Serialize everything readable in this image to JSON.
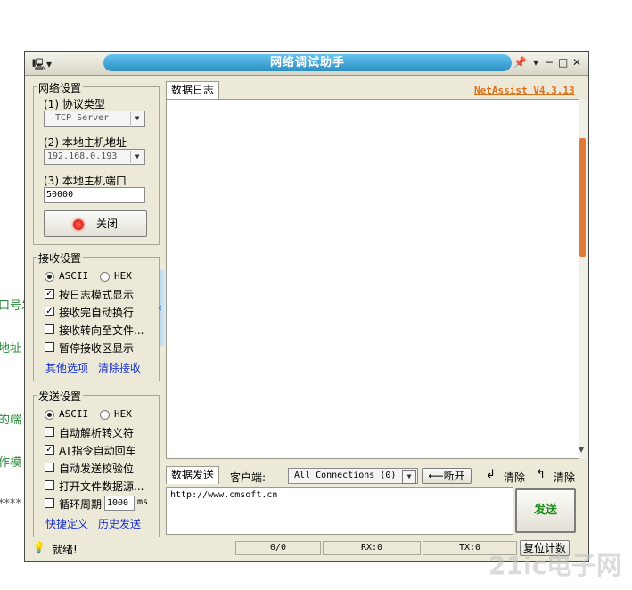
{
  "background": {
    "fragments": [
      "口号发",
      "地址",
      "的端",
      "作模",
      "****"
    ]
  },
  "window": {
    "title": "网络调试助手",
    "version_link": "NetAssist V4.3.13"
  },
  "network": {
    "group_label": "网络设置",
    "protocol_label": "(1) 协议类型",
    "protocol_value": "TCP Server",
    "host_label": "(2) 本地主机地址",
    "host_value": "192.168.0.193",
    "port_label": "(3) 本地主机端口",
    "port_value": "50000",
    "close_button": "关闭"
  },
  "receive": {
    "group_label": "接收设置",
    "ascii": "ASCII",
    "hex": "HEX",
    "options": [
      {
        "label": "按日志模式显示",
        "checked": true
      },
      {
        "label": "接收完自动换行",
        "checked": true
      },
      {
        "label": "接收转向至文件...",
        "checked": false
      },
      {
        "label": "暂停接收区显示",
        "checked": false
      }
    ],
    "link_more": "其他选项",
    "link_clear": "清除接收"
  },
  "send": {
    "group_label": "发送设置",
    "ascii": "ASCII",
    "hex": "HEX",
    "options": [
      {
        "label": "自动解析转义符",
        "checked": false
      },
      {
        "label": "AT指令自动回车",
        "checked": true
      },
      {
        "label": "自动发送校验位",
        "checked": false
      },
      {
        "label": "打开文件数据源...",
        "checked": false
      }
    ],
    "cycle_label": "循环周期",
    "cycle_value": "1000",
    "cycle_unit": "ms",
    "link_shortcut": "快捷定义",
    "link_history": "历史发送"
  },
  "log": {
    "tab": "数据日志"
  },
  "send_area": {
    "tab": "数据发送",
    "client_label": "客户端:",
    "client_select": "All Connections (0)",
    "disconnect": "断开",
    "clear1": "清除",
    "clear2": "清除",
    "text": "http://www.cmsoft.cn",
    "send_button": "发送"
  },
  "status": {
    "ready": "就绪!",
    "count": "0/0",
    "rx": "RX:0",
    "tx": "TX:0",
    "reset": "复位计数"
  },
  "watermark": "21ic电子网"
}
